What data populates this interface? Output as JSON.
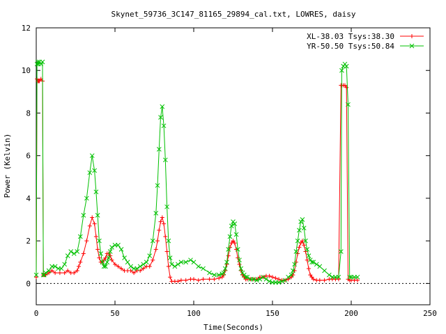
{
  "chart_data": {
    "type": "line",
    "title": "Skynet_59736_3C147_81165_29894_cal.txt, LOWRES, daisy",
    "xlabel": "Time(Seconds)",
    "ylabel": "Power (Kelvin)",
    "xlim": [
      0,
      250
    ],
    "ylim": [
      -1,
      12
    ],
    "xticks": [
      0,
      50,
      100,
      150,
      200,
      250
    ],
    "yticks": [
      0,
      2,
      4,
      6,
      8,
      10,
      12
    ],
    "grid": false,
    "legend_position": "top-right",
    "series": [
      {
        "name": "XL-38.03 Tsys:38.30",
        "color": "#ff0000",
        "marker": "plus",
        "x": [
          0,
          0.5,
          1,
          1.5,
          2,
          3,
          4,
          4.5,
          5,
          6,
          8,
          10,
          12,
          15,
          18,
          20,
          22,
          24,
          26,
          27,
          28,
          30,
          32,
          34,
          35.5,
          37,
          38,
          39,
          40,
          41,
          42,
          43,
          44,
          45,
          46,
          47,
          48,
          50,
          52,
          54,
          56,
          58,
          60,
          62,
          64,
          66,
          68,
          70,
          72,
          74,
          76,
          77,
          78,
          79,
          80,
          81,
          82,
          83,
          84,
          85,
          86,
          88,
          90,
          92,
          95,
          98,
          100,
          103,
          106,
          110,
          113,
          116,
          118,
          119,
          120,
          121,
          122,
          123,
          124,
          125,
          126,
          127,
          128,
          129,
          130,
          131,
          132,
          133,
          134,
          136,
          138,
          140,
          142,
          144,
          146,
          148,
          150,
          152,
          154,
          156,
          158,
          160,
          162,
          163,
          164,
          165,
          166,
          167,
          168,
          169,
          170,
          171,
          172,
          173,
          174,
          175,
          176,
          178,
          180,
          183,
          186,
          188,
          190,
          192,
          193.5,
          194,
          195,
          196,
          197,
          198,
          199,
          200,
          202,
          204
        ],
        "y": [
          0.3,
          9.6,
          9.5,
          9.5,
          9.5,
          9.6,
          9.5,
          0.4,
          0.4,
          0.4,
          0.5,
          0.6,
          0.5,
          0.5,
          0.5,
          0.6,
          0.5,
          0.5,
          0.6,
          0.8,
          1.0,
          1.4,
          2.0,
          2.7,
          3.1,
          2.8,
          2.2,
          1.6,
          1.2,
          1.0,
          1.0,
          1.1,
          1.2,
          1.4,
          1.4,
          1.3,
          1.1,
          0.9,
          0.8,
          0.7,
          0.6,
          0.6,
          0.6,
          0.5,
          0.6,
          0.6,
          0.7,
          0.8,
          0.8,
          1.1,
          1.6,
          2.0,
          2.5,
          2.9,
          3.1,
          2.8,
          2.2,
          1.5,
          0.8,
          0.3,
          0.1,
          0.1,
          0.1,
          0.15,
          0.15,
          0.2,
          0.2,
          0.15,
          0.2,
          0.2,
          0.2,
          0.25,
          0.3,
          0.4,
          0.6,
          0.9,
          1.3,
          1.7,
          1.9,
          2.0,
          1.9,
          1.6,
          1.2,
          0.9,
          0.6,
          0.4,
          0.3,
          0.2,
          0.2,
          0.2,
          0.2,
          0.2,
          0.3,
          0.3,
          0.35,
          0.35,
          0.3,
          0.25,
          0.2,
          0.15,
          0.15,
          0.2,
          0.3,
          0.4,
          0.6,
          1.0,
          1.4,
          1.7,
          1.9,
          2.0,
          1.8,
          1.5,
          1.1,
          0.7,
          0.4,
          0.3,
          0.2,
          0.15,
          0.15,
          0.15,
          0.2,
          0.2,
          0.2,
          0.2,
          9.3,
          9.3,
          9.3,
          9.3,
          9.2,
          0.2,
          0.15,
          0.15,
          0.15,
          0.15
        ]
      },
      {
        "name": "YR-50.50 Tsys:50.84",
        "color": "#00c000",
        "marker": "cross",
        "x": [
          0,
          0.5,
          1,
          1.5,
          2,
          3,
          4,
          4.5,
          5,
          6,
          8,
          10,
          12,
          14,
          16,
          18,
          20,
          22,
          24,
          26,
          28,
          30,
          32,
          34,
          35.5,
          37,
          38,
          39,
          40,
          41,
          42,
          43,
          44,
          45,
          46,
          47,
          48,
          50,
          52,
          54,
          56,
          58,
          60,
          62,
          64,
          66,
          68,
          70,
          72,
          74,
          76,
          77,
          78,
          79,
          80,
          81,
          82,
          83,
          84,
          85,
          86,
          88,
          90,
          92,
          95,
          98,
          100,
          103,
          106,
          110,
          113,
          116,
          118,
          119,
          120,
          121,
          122,
          123,
          124,
          125,
          126,
          127,
          128,
          129,
          130,
          131,
          132,
          133,
          134,
          136,
          138,
          140,
          142,
          144,
          146,
          148,
          150,
          152,
          154,
          156,
          158,
          160,
          162,
          163,
          164,
          165,
          166,
          167,
          168,
          169,
          170,
          171,
          172,
          173,
          174,
          175,
          176,
          178,
          180,
          183,
          186,
          188,
          190,
          192,
          193.5,
          194,
          195,
          196,
          197,
          198,
          199,
          200,
          202,
          204
        ],
        "y": [
          0.4,
          10.3,
          10.4,
          10.3,
          10.4,
          10.3,
          10.4,
          0.4,
          0.4,
          0.5,
          0.6,
          0.8,
          0.8,
          0.7,
          0.7,
          0.9,
          1.3,
          1.5,
          1.4,
          1.5,
          2.2,
          3.2,
          4.0,
          5.2,
          6.0,
          5.3,
          4.3,
          3.2,
          2.0,
          1.4,
          1.0,
          0.8,
          0.8,
          1.0,
          1.2,
          1.5,
          1.7,
          1.8,
          1.8,
          1.6,
          1.2,
          1.0,
          0.8,
          0.7,
          0.7,
          0.8,
          0.9,
          1.0,
          1.3,
          2.0,
          3.3,
          4.6,
          6.3,
          7.8,
          8.3,
          7.4,
          5.8,
          3.6,
          2.0,
          1.2,
          0.9,
          0.8,
          0.9,
          1.0,
          1.0,
          1.1,
          1.0,
          0.8,
          0.7,
          0.5,
          0.4,
          0.4,
          0.45,
          0.5,
          0.7,
          1.0,
          1.6,
          2.2,
          2.7,
          2.9,
          2.8,
          2.3,
          1.6,
          1.1,
          0.7,
          0.5,
          0.4,
          0.3,
          0.3,
          0.2,
          0.2,
          0.15,
          0.2,
          0.3,
          0.2,
          0.1,
          0.05,
          0.05,
          0.05,
          0.1,
          0.15,
          0.3,
          0.4,
          0.6,
          0.9,
          1.5,
          2.0,
          2.5,
          2.9,
          3.0,
          2.6,
          2.0,
          1.6,
          1.3,
          1.1,
          1.0,
          1.0,
          0.9,
          0.8,
          0.6,
          0.4,
          0.3,
          0.3,
          0.3,
          1.5,
          10.0,
          10.2,
          10.3,
          10.2,
          8.4,
          0.3,
          0.3,
          0.3,
          0.3
        ]
      }
    ]
  }
}
